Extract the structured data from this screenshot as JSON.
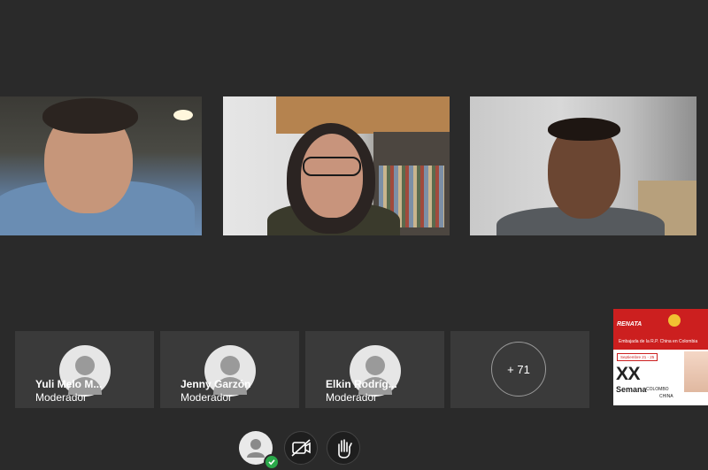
{
  "participants": [
    {
      "name": "Yuli Melo M...",
      "role": "Moderador"
    },
    {
      "name": "Jenny Garzón",
      "role": "Moderador"
    },
    {
      "name": "Elkin Rodríg...",
      "role": "Moderador"
    }
  ],
  "more_participants": "+ 71",
  "banner": {
    "logo": "RENATA",
    "org_line": "Embajada de la R.P. China en Colombia",
    "dates": "Septiembre 21 - 25",
    "edition": "XX",
    "event": "Semana",
    "country1": "COLOMBO",
    "country2": "CHINA"
  },
  "controls": [
    {
      "icon": "user-icon",
      "status": "connected"
    },
    {
      "icon": "video-off-icon"
    },
    {
      "icon": "raise-hand-icon"
    }
  ],
  "colors": {
    "background": "#2a2a2a",
    "tile": "#3a3a3a",
    "accent": "#2aa84a",
    "banner_red": "#cc1f1f"
  }
}
